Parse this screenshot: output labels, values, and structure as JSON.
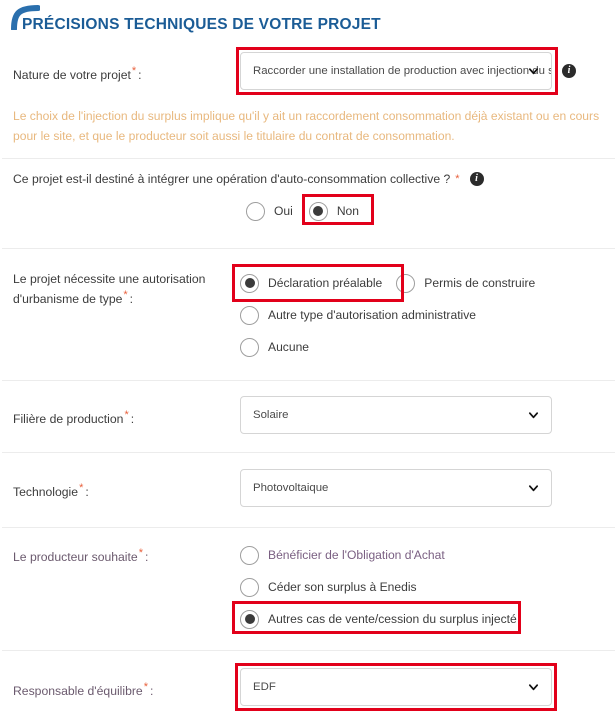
{
  "header": {
    "title": "PRÉCISIONS TECHNIQUES DE VOTRE PROJET",
    "accent_color": "#1b5c96",
    "arc_icon": "corner-arc-icon"
  },
  "colors": {
    "highlight_box": "#e2001a",
    "required_asterisk": "#e8603c",
    "warning_text": "#e8b87e",
    "label_violet": "#7a5f82",
    "select_border": "#d5d5d5"
  },
  "nature": {
    "label": "Nature de votre projet",
    "required": "*",
    "colon": ":",
    "value": "Raccorder une installation de production avec injection du surplus",
    "info_tooltip_icon": "info-icon",
    "caret_icon": "chevron-down-icon",
    "highlighted": true
  },
  "warning": {
    "line1": "Le choix de l'injection du surplus implique qu'il y ait un raccordement consommation déjà existant ou en cours",
    "line2": "pour le site, et que le producteur soit aussi le titulaire du contrat de consommation."
  },
  "collective": {
    "question": "Ce projet est-il destiné à intégrer une opération d'auto-consommation collective ?",
    "required": "*",
    "info_tooltip_icon": "info-icon",
    "options": [
      {
        "label": "Oui",
        "checked": false,
        "highlighted": false
      },
      {
        "label": "Non",
        "checked": true,
        "highlighted": true
      }
    ]
  },
  "urbanisme": {
    "label_line1": "Le projet nécessite une autorisation",
    "label_line2": "d'urbanisme de type",
    "required": "*",
    "colon": ":",
    "options": [
      {
        "label": "Déclaration préalable",
        "checked": true,
        "highlighted": true
      },
      {
        "label": "Permis de construire",
        "checked": false,
        "highlighted": false
      },
      {
        "label": "Autre type d'autorisation administrative",
        "checked": false,
        "highlighted": false
      },
      {
        "label": "Aucune",
        "checked": false,
        "highlighted": false
      }
    ]
  },
  "filiere": {
    "label": "Filière de production",
    "required": "*",
    "colon": ":",
    "value": "Solaire",
    "caret_icon": "chevron-down-icon",
    "highlighted": false
  },
  "technologie": {
    "label": "Technologie",
    "required": "*",
    "colon": ":",
    "value": "Photovoltaique",
    "caret_icon": "chevron-down-icon",
    "highlighted": false
  },
  "producteur": {
    "label": "Le producteur souhaite",
    "required": "*",
    "colon": ":",
    "options": [
      {
        "label": "Bénéficier de l'Obligation d'Achat",
        "checked": false,
        "highlighted": false
      },
      {
        "label": "Céder son surplus à Enedis",
        "checked": false,
        "highlighted": false
      },
      {
        "label": "Autres cas de vente/cession du surplus injecté",
        "checked": true,
        "highlighted": true
      }
    ]
  },
  "responsable": {
    "label": "Responsable d'équilibre",
    "required": "*",
    "colon": ":",
    "value": "EDF",
    "caret_icon": "chevron-down-icon",
    "highlighted": true
  }
}
